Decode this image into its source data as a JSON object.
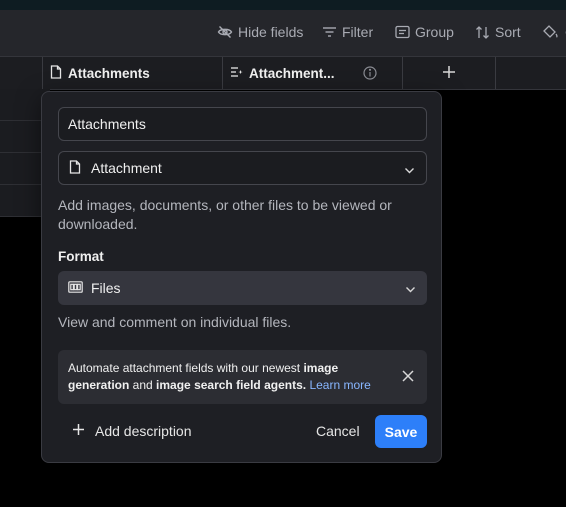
{
  "toolbar": {
    "hide_fields": "Hide fields",
    "filter": "Filter",
    "group": "Group",
    "sort": "Sort",
    "color_icon": "paint-bucket-icon"
  },
  "columns": {
    "attachments": "Attachments",
    "attachment_truncated": "Attachment...",
    "add_icon": "plus-icon"
  },
  "popover": {
    "field_name": "Attachments",
    "field_type": "Attachment",
    "field_type_icon": "document-icon",
    "type_description": "Add images, documents, or other files to be viewed or downloaded.",
    "format_label": "Format",
    "format_value": "Files",
    "format_icon": "files-view-icon",
    "format_description": "View and comment on individual files.",
    "banner": {
      "text_before": "Automate attachment fields with our newest ",
      "bold_1": "image generation",
      "text_mid": " and ",
      "bold_2": "image search field agents.",
      "link": "Learn more"
    },
    "add_description": "Add description",
    "cancel": "Cancel",
    "save": "Save"
  },
  "colors": {
    "accent": "#2d7ff9",
    "link": "#88b6ff",
    "background": "#000000",
    "panel": "#1e1f24"
  }
}
